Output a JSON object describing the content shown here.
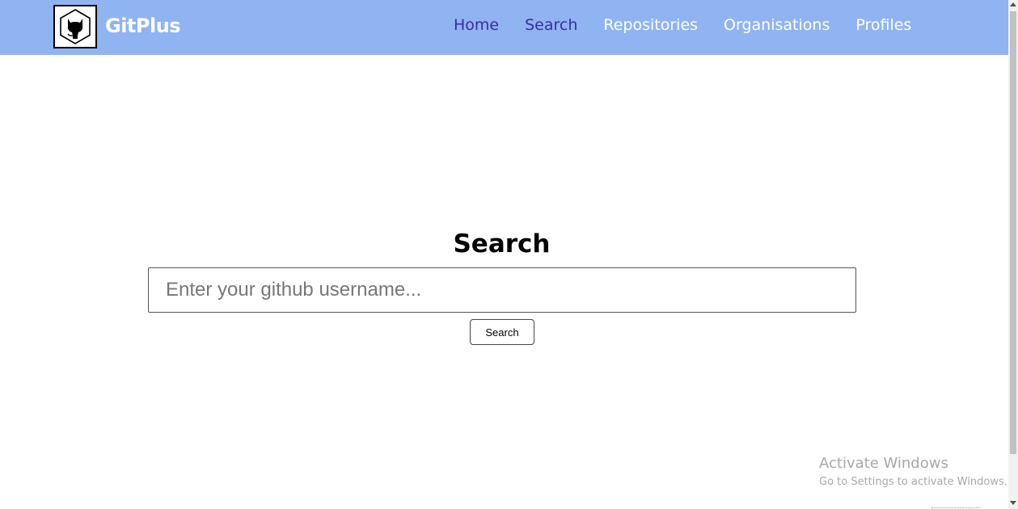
{
  "navbar": {
    "brand": "GitPlus",
    "logo_icon": "github-octocat-icon",
    "links": [
      {
        "label": "Home",
        "active": true
      },
      {
        "label": "Search",
        "active": true
      },
      {
        "label": "Repositories",
        "active": false
      },
      {
        "label": "Organisations",
        "active": false
      },
      {
        "label": "Profiles",
        "active": false
      }
    ],
    "background_color": "#90b4f1",
    "active_link_color": "#3b2aa6"
  },
  "main": {
    "title": "Search",
    "search_input": {
      "value": "",
      "placeholder": "Enter your github username..."
    },
    "search_button_label": "Search"
  },
  "watermark": {
    "title": "Activate Windows",
    "subtitle": "Go to Settings to activate Windows."
  }
}
